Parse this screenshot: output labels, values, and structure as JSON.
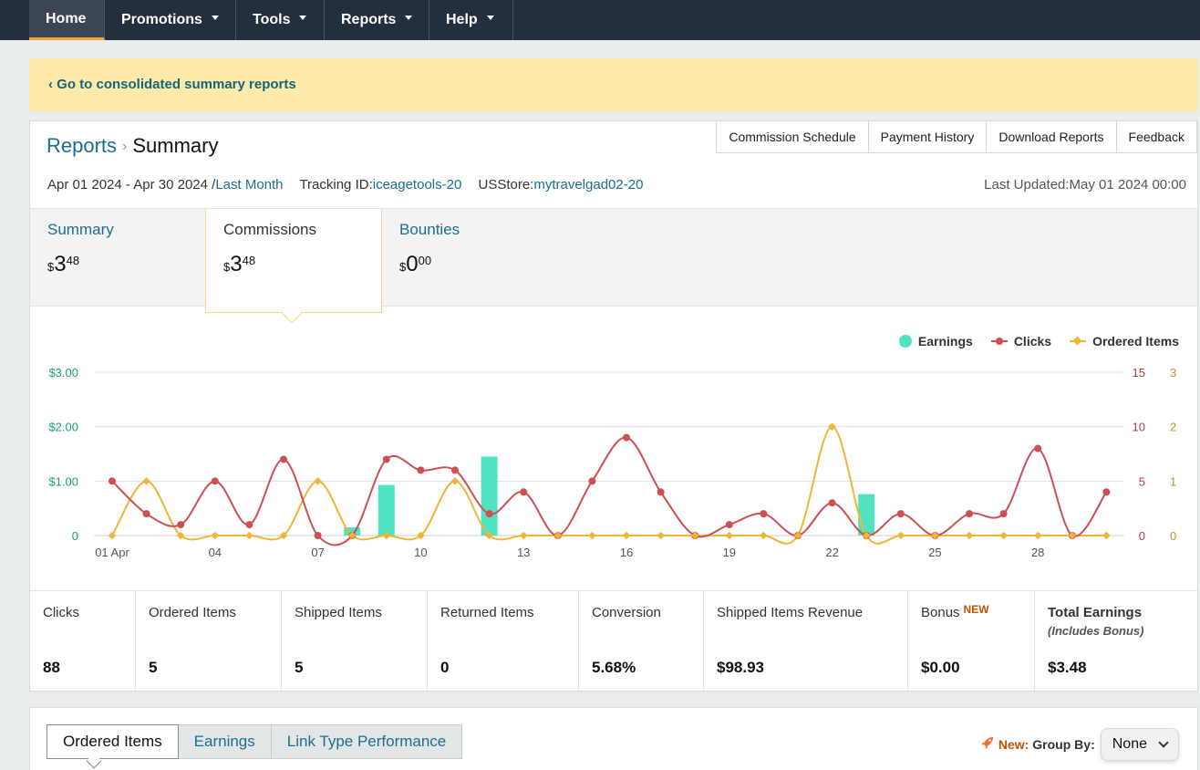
{
  "nav": {
    "items": [
      {
        "label": "Home",
        "has_caret": false,
        "active": true
      },
      {
        "label": "Promotions",
        "has_caret": true
      },
      {
        "label": "Tools",
        "has_caret": true
      },
      {
        "label": "Reports",
        "has_caret": true
      },
      {
        "label": "Help",
        "has_caret": true
      }
    ]
  },
  "banner": {
    "link": "‹ Go to consolidated summary reports"
  },
  "breadcrumb": {
    "parent": "Reports",
    "separator": "›",
    "current": "Summary"
  },
  "toolbar": {
    "commission_schedule": "Commission Schedule",
    "payment_history": "Payment History",
    "download_reports": "Download Reports",
    "feedback": "Feedback"
  },
  "meta": {
    "date_range": "Apr 01 2024 - Apr 30 2024 /",
    "period": "Last Month",
    "tracking_label": "Tracking ID:",
    "tracking_id": "iceagetools-20",
    "store_label": "USStore:",
    "store_id": "mytravelgad02-20",
    "last_updated": "Last Updated:May 01 2024 00:00"
  },
  "summary_tabs": [
    {
      "title": "Summary",
      "currency": "$",
      "whole": "3",
      "cents": "48",
      "active": false
    },
    {
      "title": "Commissions",
      "currency": "$",
      "whole": "3",
      "cents": "48",
      "active": true
    },
    {
      "title": "Bounties",
      "currency": "$",
      "whole": "0",
      "cents": "00",
      "active": false
    }
  ],
  "chart_data": {
    "type": "line",
    "legend": [
      {
        "name": "Earnings",
        "color": "#50e3c2",
        "kind": "bar"
      },
      {
        "name": "Clicks",
        "color": "#cd4f52",
        "kind": "line"
      },
      {
        "name": "Ordered Items",
        "color": "#f0b537",
        "kind": "line"
      }
    ],
    "x": [
      "01",
      "02",
      "03",
      "04",
      "05",
      "06",
      "07",
      "08",
      "09",
      "10",
      "11",
      "12",
      "13",
      "14",
      "15",
      "16",
      "17",
      "18",
      "19",
      "20",
      "21",
      "22",
      "23",
      "24",
      "25",
      "26",
      "27",
      "28",
      "29",
      "30"
    ],
    "x_tick_labels": [
      {
        "day": 1,
        "label": "01 Apr"
      },
      {
        "day": 4,
        "label": "04"
      },
      {
        "day": 7,
        "label": "07"
      },
      {
        "day": 10,
        "label": "10"
      },
      {
        "day": 13,
        "label": "13"
      },
      {
        "day": 16,
        "label": "16"
      },
      {
        "day": 19,
        "label": "19"
      },
      {
        "day": 22,
        "label": "22"
      },
      {
        "day": 25,
        "label": "25"
      },
      {
        "day": 28,
        "label": "28"
      }
    ],
    "y_left": {
      "ticks": [
        "0",
        "$1.00",
        "$2.00",
        "$3.00"
      ],
      "values": [
        0,
        1,
        2,
        3
      ],
      "lim": [
        0,
        3
      ],
      "color": "#1e9d7e"
    },
    "y_right1": {
      "ticks": [
        "0",
        "5",
        "10",
        "15"
      ],
      "values": [
        0,
        5,
        10,
        15
      ],
      "lim": [
        0,
        15
      ],
      "color": "#b23b3d"
    },
    "y_right2": {
      "ticks": [
        "0",
        "1",
        "2",
        "3"
      ],
      "values": [
        0,
        1,
        2,
        3
      ],
      "lim": [
        0,
        3
      ],
      "color": "#c4932a"
    },
    "series": [
      {
        "name": "Earnings",
        "axis": "left",
        "values": [
          0,
          0,
          0,
          0,
          0,
          0,
          0,
          0.15,
          0.93,
          0,
          0,
          1.45,
          0,
          0,
          0,
          0,
          0,
          0,
          0,
          0,
          0,
          0,
          0.76,
          0,
          0,
          0,
          0,
          0,
          0,
          0
        ]
      },
      {
        "name": "Clicks",
        "axis": "right1",
        "values": [
          5,
          2,
          1,
          5,
          1,
          7,
          0,
          0,
          7,
          6,
          6,
          2,
          4,
          0,
          5,
          9,
          4,
          0,
          1,
          2,
          0,
          3,
          0,
          2,
          0,
          2,
          2,
          8,
          0,
          4
        ]
      },
      {
        "name": "Ordered Items",
        "axis": "right2",
        "values": [
          0,
          1,
          0,
          0,
          0,
          0,
          1,
          0,
          0,
          0,
          1,
          0,
          0,
          0,
          0,
          0,
          0,
          0,
          0,
          0,
          0,
          2,
          0,
          0,
          0,
          0,
          0,
          0,
          0,
          0
        ]
      }
    ],
    "grid": true,
    "legend_position": "top-right"
  },
  "stats": [
    {
      "label": "Clicks",
      "value": "88"
    },
    {
      "label": "Ordered Items",
      "value": "5"
    },
    {
      "label": "Shipped Items",
      "value": "5"
    },
    {
      "label": "Returned Items",
      "value": "0"
    },
    {
      "label": "Conversion",
      "value": "5.68%"
    },
    {
      "label": "Shipped Items Revenue",
      "value": "$98.93"
    },
    {
      "label": "Bonus",
      "tag": "NEW",
      "value": "$0.00"
    },
    {
      "label": "Total Earnings",
      "sub": "(Includes Bonus)",
      "value": "$3.48"
    }
  ],
  "bottom_tabs": [
    {
      "label": "Ordered Items",
      "active": true
    },
    {
      "label": "Earnings",
      "active": false
    },
    {
      "label": "Link Type Performance",
      "active": false
    }
  ],
  "group_by": {
    "new_label": "New:",
    "label": "Group By:",
    "value": "None",
    "icon": "rocket-icon"
  }
}
